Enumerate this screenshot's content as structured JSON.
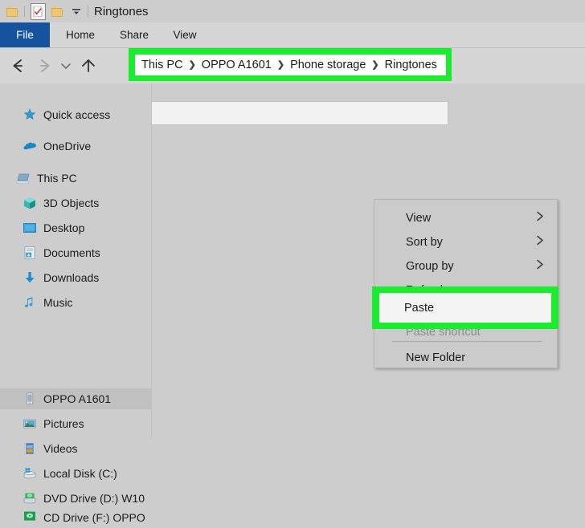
{
  "window": {
    "title": "Ringtones",
    "quick_access_icons": [
      "folder-icon",
      "document-check-icon",
      "folder-icon",
      "customize-dropdown-icon"
    ]
  },
  "ribbon": {
    "tabs": [
      {
        "label": "File",
        "active": true
      },
      {
        "label": "Home",
        "active": false
      },
      {
        "label": "Share",
        "active": false
      },
      {
        "label": "View",
        "active": false
      }
    ]
  },
  "navigation": {
    "back_icon": "arrow-left-icon",
    "forward_icon": "arrow-right-icon",
    "recent_icon": "chevron-down-icon",
    "up_icon": "arrow-up-icon"
  },
  "address_bar": {
    "icon": "folder-icon",
    "overflow": "››",
    "breadcrumbs": [
      "This PC",
      "OPPO A1601",
      "Phone storage",
      "Ringtones"
    ],
    "separator": "❯",
    "highlight_color": "#1aec2e"
  },
  "sidebar": {
    "items": [
      {
        "label": "Quick access",
        "icon": "star-pin-icon",
        "selected": false,
        "indent": 0
      },
      {
        "label": "OneDrive",
        "icon": "cloud-icon",
        "selected": false,
        "indent": 0
      },
      {
        "label": "This PC",
        "icon": "computer-icon",
        "selected": false,
        "indent": 0
      },
      {
        "label": "3D Objects",
        "icon": "3d-objects-icon",
        "selected": false,
        "indent": 1
      },
      {
        "label": "Desktop",
        "icon": "desktop-icon",
        "selected": false,
        "indent": 1
      },
      {
        "label": "Documents",
        "icon": "documents-icon",
        "selected": false,
        "indent": 1
      },
      {
        "label": "Downloads",
        "icon": "downloads-icon",
        "selected": false,
        "indent": 1
      },
      {
        "label": "Music",
        "icon": "music-note-icon",
        "selected": false,
        "indent": 1
      },
      {
        "label": "OPPO A1601",
        "icon": "phone-icon",
        "selected": true,
        "indent": 1
      },
      {
        "label": "Pictures",
        "icon": "pictures-icon",
        "selected": false,
        "indent": 1
      },
      {
        "label": "Videos",
        "icon": "videos-icon",
        "selected": false,
        "indent": 1
      },
      {
        "label": "Local Disk (C:)",
        "icon": "hard-drive-icon",
        "selected": false,
        "indent": 1
      },
      {
        "label": "DVD Drive (D:) W10",
        "icon": "dvd-drive-icon",
        "selected": false,
        "indent": 1
      },
      {
        "label": "CD Drive (F:) OPPO",
        "icon": "cd-drive-icon",
        "selected": false,
        "indent": 1
      }
    ]
  },
  "context_menu": {
    "items": [
      {
        "label": "View",
        "submenu": true,
        "disabled": false
      },
      {
        "label": "Sort by",
        "submenu": true,
        "disabled": false
      },
      {
        "label": "Group by",
        "submenu": true,
        "disabled": false
      },
      {
        "label": "Refresh",
        "submenu": false,
        "disabled": false
      },
      {
        "label": "Paste",
        "submenu": false,
        "disabled": false,
        "highlighted": true
      },
      {
        "label": "Paste shortcut",
        "submenu": false,
        "disabled": true
      },
      {
        "label": "New Folder",
        "submenu": false,
        "disabled": false
      }
    ],
    "highlight_color": "#1aec2e"
  }
}
